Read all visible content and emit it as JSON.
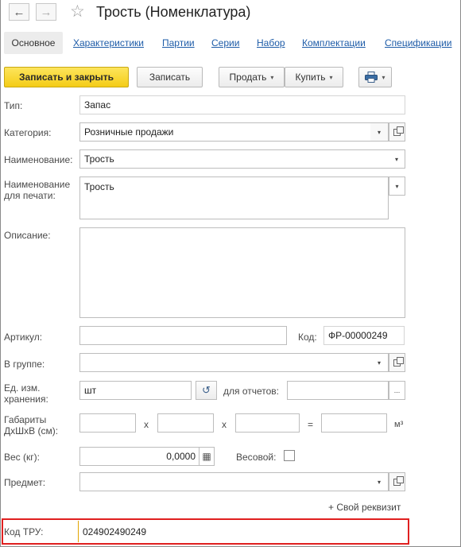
{
  "window": {
    "title": "Трость (Номенклатура)"
  },
  "nav": {
    "back": "←",
    "forward": "→",
    "favorite": "☆"
  },
  "tabs": [
    "Основное",
    "Характеристики",
    "Партии",
    "Серии",
    "Набор",
    "Комплектации",
    "Спецификации"
  ],
  "toolbar": {
    "save_close": "Записать и закрыть",
    "save": "Записать",
    "sell": "Продать",
    "buy": "Купить",
    "dropdown_caret": "▾"
  },
  "icons": {
    "calc": "▦",
    "history": "↺",
    "more": "...",
    "dd": "▾"
  },
  "form": {
    "type_label": "Тип:",
    "type_value": "Запас",
    "category_label": "Категория:",
    "category_value": "Розничные продажи",
    "name_label": "Наименование:",
    "name_value": "Трость",
    "print_name_label": "Наименование для печати:",
    "print_name_value": "Трость",
    "description_label": "Описание:",
    "description_value": "",
    "article_label": "Артикул:",
    "article_value": "",
    "code_label": "Код:",
    "code_value": "ФР-00000249",
    "group_label": "В группе:",
    "group_value": "",
    "unit_label": "Ед. изм. хранения:",
    "unit_value": "шт",
    "report_unit_label": "для отчетов:",
    "report_unit_value": "",
    "dims_label": "Габариты ДхШхВ (см):",
    "dims_x1": "x",
    "dims_x2": "x",
    "dims_eq": "=",
    "dims_unit": "м³",
    "weight_label": "Вес (кг):",
    "weight_value": "0,0000",
    "weighted_label": "Весовой:",
    "weighted_checked": false,
    "subject_label": "Предмет:",
    "subject_value": "",
    "add_attribute": "+ Свой реквизит",
    "tru_label": "Код ТРУ:",
    "tru_value": "024902490249"
  }
}
